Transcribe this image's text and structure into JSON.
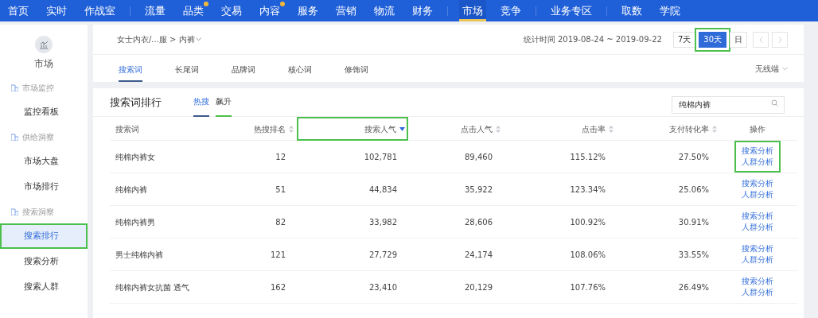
{
  "top_nav": [
    [
      {
        "label": "首页",
        "selected": false,
        "dot": false
      },
      {
        "label": "实时",
        "selected": false,
        "dot": false
      },
      {
        "label": "作战室",
        "selected": false,
        "dot": false
      }
    ],
    [
      {
        "label": "流量",
        "selected": false,
        "dot": false
      },
      {
        "label": "品类",
        "selected": false,
        "dot": true
      },
      {
        "label": "交易",
        "selected": false,
        "dot": false
      },
      {
        "label": "内容",
        "selected": false,
        "dot": true
      },
      {
        "label": "服务",
        "selected": false,
        "dot": false
      },
      {
        "label": "营销",
        "selected": false,
        "dot": false
      },
      {
        "label": "物流",
        "selected": false,
        "dot": false
      },
      {
        "label": "财务",
        "selected": false,
        "dot": false
      }
    ],
    [
      {
        "label": "市场",
        "selected": true,
        "dot": false
      },
      {
        "label": "竞争",
        "selected": false,
        "dot": false
      }
    ],
    [
      {
        "label": "业务专区",
        "selected": false,
        "dot": false
      }
    ],
    [
      {
        "label": "取数",
        "selected": false,
        "dot": false
      },
      {
        "label": "学院",
        "selected": false,
        "dot": false
      }
    ]
  ],
  "sidebar": {
    "title": "市场",
    "items": [
      {
        "kind": "group",
        "label": "市场监控"
      },
      {
        "kind": "link",
        "label": "监控看板",
        "selected": false,
        "highlighted": false
      },
      {
        "kind": "group",
        "label": "供给洞察"
      },
      {
        "kind": "link",
        "label": "市场大盘",
        "selected": false,
        "highlighted": false
      },
      {
        "kind": "link",
        "label": "市场排行",
        "selected": false,
        "highlighted": false
      },
      {
        "kind": "group",
        "label": "搜索洞察"
      },
      {
        "kind": "link",
        "label": "搜索排行",
        "selected": true,
        "highlighted": true
      },
      {
        "kind": "link",
        "label": "搜索分析",
        "selected": false,
        "highlighted": false
      },
      {
        "kind": "link",
        "label": "搜索人群",
        "selected": false,
        "highlighted": false
      }
    ]
  },
  "header": {
    "breadcrumb": "女士内衣/...服 > 内裤",
    "stat_time": "统计时间 2019-08-24 ~ 2019-09-22",
    "periods": [
      {
        "label": "7天",
        "selected": false,
        "highlighted": false
      },
      {
        "label": "30天",
        "selected": true,
        "highlighted": true
      },
      {
        "label": "日",
        "selected": false,
        "highlighted": false
      }
    ],
    "tabs": [
      {
        "label": "搜索词",
        "selected": true
      },
      {
        "label": "长尾词",
        "selected": false
      },
      {
        "label": "品牌词",
        "selected": false
      },
      {
        "label": "核心词",
        "selected": false
      },
      {
        "label": "修饰词",
        "selected": false
      }
    ],
    "device": "无线端"
  },
  "ranking": {
    "title": "搜索词排行",
    "tabs": [
      {
        "label": "热搜",
        "selected": true
      },
      {
        "label": "飙升",
        "selected": false,
        "highlighted": true
      }
    ],
    "search_value": "纯棉内裤",
    "columns": [
      {
        "label": "搜索词",
        "sortable": false,
        "highlighted": false
      },
      {
        "label": "热搜排名",
        "sortable": true,
        "sorted_desc": false,
        "highlighted": false
      },
      {
        "label": "搜索人气",
        "sortable": true,
        "sorted_desc": true,
        "highlighted": true
      },
      {
        "label": "点击人气",
        "sortable": true,
        "sorted_desc": false,
        "highlighted": false
      },
      {
        "label": "点击率",
        "sortable": true,
        "sorted_desc": false,
        "highlighted": false
      },
      {
        "label": "支付转化率",
        "sortable": true,
        "sorted_desc": false,
        "highlighted": false
      },
      {
        "label": "操作",
        "sortable": false,
        "highlighted": false
      }
    ],
    "rows": [
      {
        "cells": [
          "纯棉内裤女",
          "12",
          "102,781",
          "89,460",
          "115.12%",
          "27.50%"
        ],
        "actions": [
          "搜索分析",
          "人群分析"
        ],
        "highlighted": true
      },
      {
        "cells": [
          "纯棉内裤",
          "51",
          "44,834",
          "35,922",
          "123.34%",
          "25.06%"
        ],
        "actions": [
          "搜索分析",
          "人群分析"
        ],
        "highlighted": false
      },
      {
        "cells": [
          "纯棉内裤男",
          "82",
          "33,982",
          "28,606",
          "100.92%",
          "30.91%"
        ],
        "actions": [
          "搜索分析",
          "人群分析"
        ],
        "highlighted": false
      },
      {
        "cells": [
          "男士纯棉内裤",
          "121",
          "27,729",
          "24,174",
          "108.06%",
          "33.55%"
        ],
        "actions": [
          "搜索分析",
          "人群分析"
        ],
        "highlighted": false
      },
      {
        "cells": [
          "纯棉内裤女抗菌 透气",
          "162",
          "23,410",
          "20,129",
          "107.76%",
          "26.49%"
        ],
        "actions": [
          "搜索分析",
          "人群分析"
        ],
        "highlighted": false
      }
    ]
  }
}
